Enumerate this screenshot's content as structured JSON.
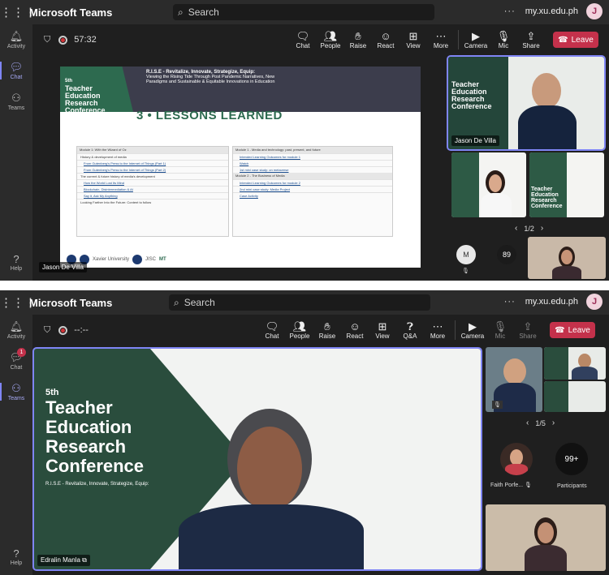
{
  "top": {
    "app_name": "Microsoft Teams",
    "search_placeholder": "Search",
    "org": "my.xu.edu.ph",
    "user_initial": "J",
    "more": "···"
  },
  "rail": {
    "activity": "Activity",
    "chat": "Chat",
    "teams": "Teams",
    "help": "Help",
    "chat_badge": "1"
  },
  "call1": {
    "timer": "57:32",
    "controls": [
      "Chat",
      "People",
      "Raise",
      "React",
      "View",
      "More"
    ],
    "devices": [
      "Camera",
      "Mic",
      "Share"
    ],
    "leave": "Leave",
    "presenter_name": "Jason De Villa",
    "speaker_name": "Jason De Villa",
    "pager": "1/2",
    "overflow_initial": "M",
    "overflow_count": "89",
    "slide": {
      "edition": "5th",
      "title_lines": [
        "Teacher",
        "Education",
        "Research",
        "Conference"
      ],
      "rise_title": "R.I.S.E - Revitalize, Innovate, Strategize, Equip:",
      "rise_sub": "Viewing the Rising Tide Through Post Pandemic Narratives, New Paradigms and Sustainable & Equitable Innovations in Education",
      "heading": "3 • LESSONS LEARNED",
      "left_modules": [
        {
          "type": "head",
          "text": "Module 1: With the Wizard of Oz"
        },
        {
          "type": "text",
          "text": "History & development of media"
        },
        {
          "type": "link",
          "text": "From Gutenberg's Press to the Internet of Things (Part 1)"
        },
        {
          "type": "link",
          "text": "From Gutenberg's Press to the Internet of Things (Part 2)"
        },
        {
          "type": "text",
          "text": "The current & future history of media's development"
        },
        {
          "type": "link",
          "text": "How the World Lost Its Mind"
        },
        {
          "type": "link",
          "text": "Blockchain, Disintermediation & AI"
        },
        {
          "type": "link",
          "text": "Say it, Ask My Anything"
        },
        {
          "type": "text",
          "text": "Looking Farther Into the Future: Content to follow"
        }
      ],
      "right_modules": [
        {
          "type": "head",
          "text": "Module 1 - Media and technology: past, present, and future"
        },
        {
          "type": "link",
          "text": "Intended Learning Outcomes for module 1"
        },
        {
          "type": "link",
          "text": "Watch"
        },
        {
          "type": "link",
          "text": "1st mini case study: on metaverse"
        },
        {
          "type": "head",
          "text": "Module 2 - The Business of Media"
        },
        {
          "type": "link",
          "text": "Intended Learning Outcomes for module 2"
        },
        {
          "type": "link",
          "text": "2nd mini case study: Media Project"
        },
        {
          "type": "link",
          "text": "Case Activity"
        }
      ],
      "logo_texts": [
        "Xavier University",
        "JISC",
        "MT"
      ]
    }
  },
  "call2": {
    "timer": "--:--",
    "controls": [
      "Chat",
      "People",
      "Raise",
      "React",
      "View",
      "Q&A",
      "More"
    ],
    "devices": [
      "Camera",
      "Mic",
      "Share"
    ],
    "leave": "Leave",
    "main_name": "Edralin Manla",
    "pager": "1/5",
    "participant_name": "Faith Porfe...",
    "participants_count": "99+",
    "participants_label": "Participants",
    "bg_edition": "5th",
    "bg_title_lines": [
      "Teacher",
      "Education",
      "Research",
      "Conference"
    ],
    "bg_rise": "R.I.S.E - Revitalize, Innovate, Strategize, Equip:"
  }
}
